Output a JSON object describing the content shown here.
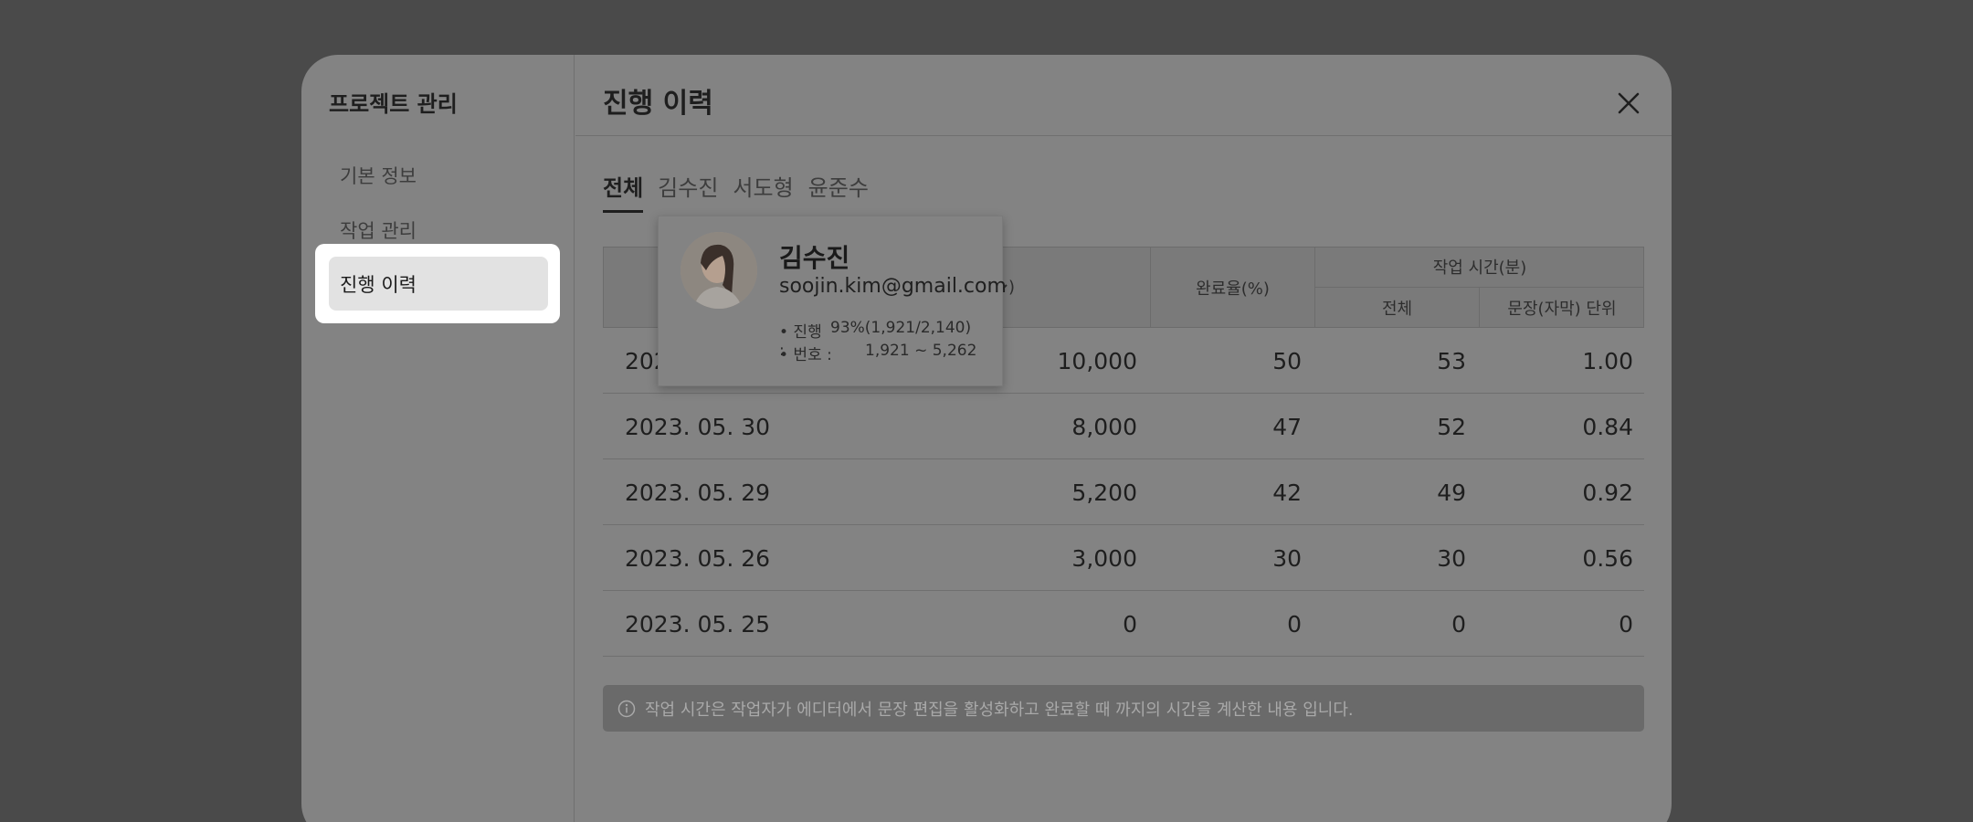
{
  "sidebar": {
    "title": "프로젝트 관리",
    "items": [
      {
        "label": "기본 정보"
      },
      {
        "label": "작업 관리"
      },
      {
        "label": "진행 이력"
      }
    ]
  },
  "main": {
    "title": "진행 이력",
    "tabs": [
      {
        "label": "전체",
        "active": true
      },
      {
        "label": "김수진"
      },
      {
        "label": "서도형"
      },
      {
        "label": "윤준수"
      }
    ],
    "table": {
      "headers": {
        "count_suffix": ")",
        "rate": "완료율(%)",
        "time_group": "작업 시간(분)",
        "time_total": "전체",
        "time_unit": "문장(자막) 단위"
      },
      "rows": [
        {
          "date": "202",
          "count": "10,000",
          "rate": "50",
          "total": "53",
          "unit": "1.00"
        },
        {
          "date": "2023. 05. 30",
          "count": "8,000",
          "rate": "47",
          "total": "52",
          "unit": "0.84"
        },
        {
          "date": "2023. 05. 29",
          "count": "5,200",
          "rate": "42",
          "total": "49",
          "unit": "0.92"
        },
        {
          "date": "2023. 05. 26",
          "count": "3,000",
          "rate": "30",
          "total": "30",
          "unit": "0.56"
        },
        {
          "date": "2023. 05. 25",
          "count": "0",
          "rate": "0",
          "total": "0",
          "unit": "0"
        }
      ]
    },
    "notice": "작업 시간은 작업자가 에디터에서 문장 편집을 활성화하고 완료할 때 까지의 시간을 계산한 내용 입니다."
  },
  "popover": {
    "name": "김수진",
    "email": "soojin.kim@gmail.com",
    "progress_key": "• 진행 :",
    "progress_value": "93%(1,921/2,140)",
    "number_key": "• 번호 :",
    "number_value": "1,921 ~ 5,262"
  },
  "icons": {
    "close": "close-icon",
    "info": "info-icon",
    "chevron": "chevron-down-icon"
  }
}
